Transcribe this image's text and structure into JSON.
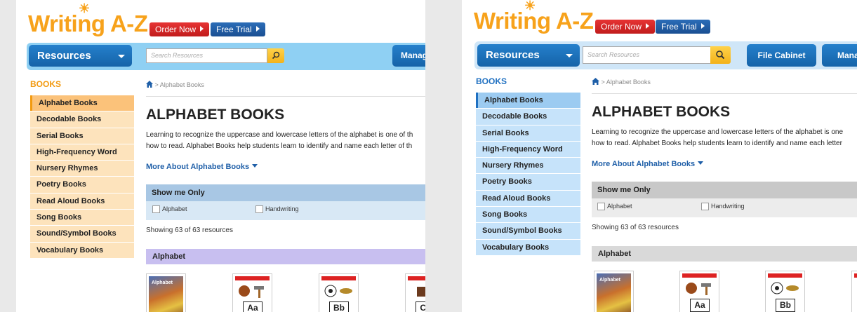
{
  "header": {
    "logo": "Writing A-Z",
    "order_now": "Order Now",
    "free_trial": "Free Trial"
  },
  "nav": {
    "resources": "Resources",
    "search_placeholder": "Search Resources",
    "file_cabinet": "File Cabinet",
    "manage_truncated_a": "Manag",
    "manage_truncated_b": "Mana"
  },
  "sidebar": {
    "heading": "BOOKS",
    "items": [
      {
        "label": "Alphabet Books"
      },
      {
        "label": "Decodable Books"
      },
      {
        "label": "Serial  Books"
      },
      {
        "label": "High-Frequency Word"
      },
      {
        "label": "Nursery Rhymes"
      },
      {
        "label": "Poetry Books"
      },
      {
        "label": "Read Aloud Books"
      },
      {
        "label": "Song Books"
      },
      {
        "label": "Sound/Symbol Books"
      },
      {
        "label": "Vocabulary Books"
      }
    ]
  },
  "panel_a_sidebar_items": [
    "Alphabet Books",
    "Decodable Books",
    "Serial  Books",
    "High-Frequency Word",
    "Nursery Rhymes",
    "Poetry Books",
    "Sound/Symbol Books",
    "Vocabulary Books"
  ],
  "breadcrumb": {
    "separator": ">",
    "current": "Alphabet Books"
  },
  "main": {
    "title": "ALPHABET BOOKS",
    "description_line1_a": "Learning to recognize the uppercase and lowercase letters of the alphabet is one of th",
    "description_line2_a": "how to read. Alphabet Books help students learn to identify and name each letter of th",
    "description_line1_b": "Learning to recognize the uppercase and lowercase letters of the alphabet is one",
    "description_line2_b": "how to read. Alphabet Books help students learn to identify and name each letter",
    "more_link": "More About Alphabet Books"
  },
  "filters": {
    "heading": "Show me Only",
    "options": [
      "Alphabet",
      "Handwriting"
    ]
  },
  "results": {
    "showing": "Showing 63 of 63 resources",
    "section": "Alphabet"
  },
  "cards": [
    {
      "label": "",
      "cover_text": "Alphabet"
    },
    {
      "label": "Aa"
    },
    {
      "label": "Bb"
    },
    {
      "label": "Cc"
    }
  ],
  "colors": {
    "sidebar_a_bg": "#fde3bc",
    "sidebar_a_active": "#fbc27a",
    "sidebar_a_border": "#f29a10",
    "sidebar_b_bg": "#c6e3fa",
    "sidebar_b_active": "#9ccbf1",
    "sidebar_b_border": "#1f70c1",
    "filter_a_head": "#a8c7e4",
    "filter_a_body": "#d8e8f5",
    "filter_b_head": "#c8c8c8",
    "filter_b_body": "#ececec",
    "section_a": "#c8bff0",
    "section_b": "#d9d9d9"
  }
}
